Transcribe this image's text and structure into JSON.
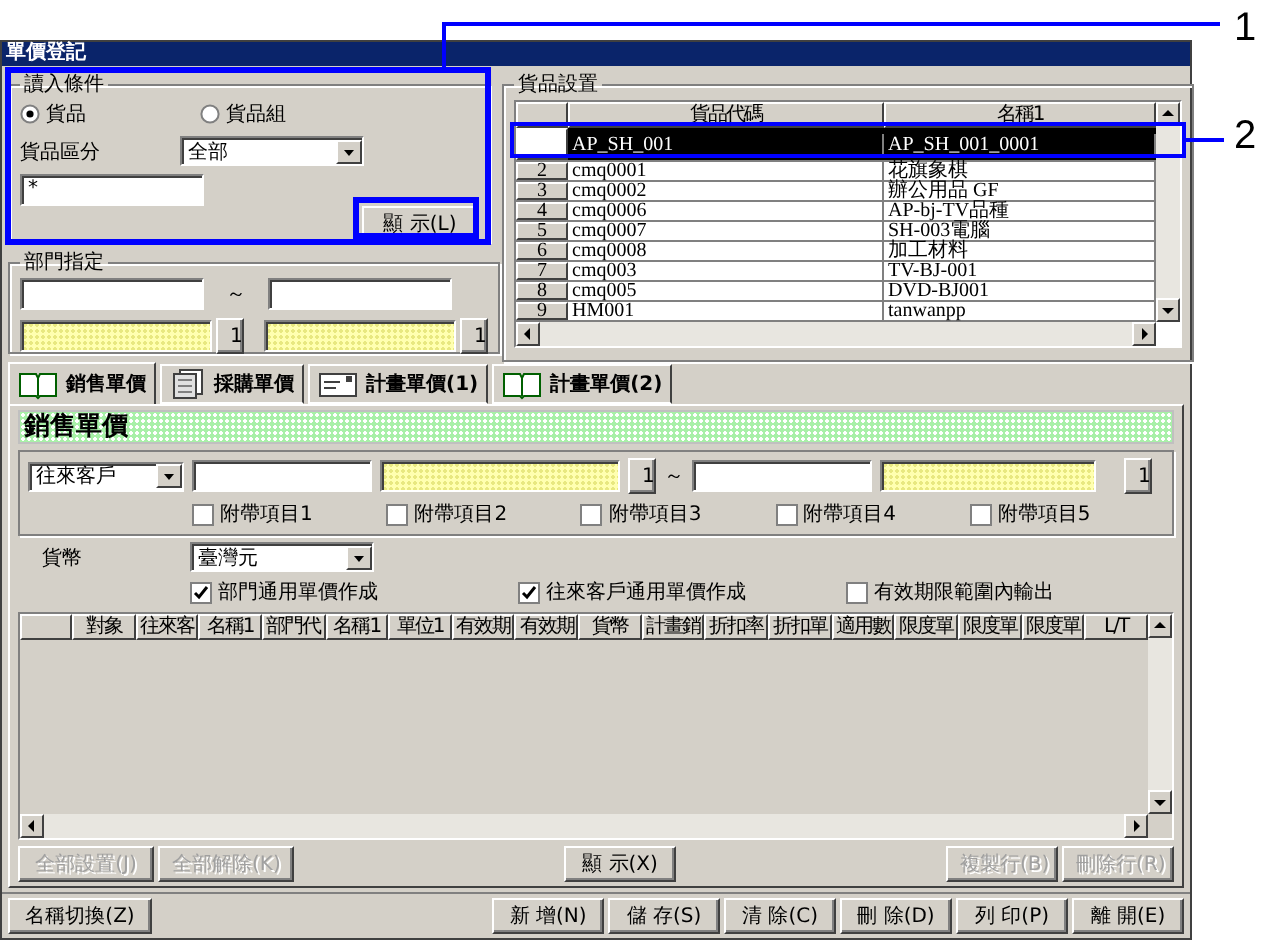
{
  "window": {
    "title": "單價登記"
  },
  "read_conditions": {
    "legend": "讀入條件",
    "options": [
      {
        "label": "貨品",
        "selected": true
      },
      {
        "label": "貨品組",
        "selected": false
      }
    ],
    "category_label": "貨品區分",
    "category_value": "全部",
    "code_value": "*",
    "show_button": "顯 示(L)"
  },
  "department": {
    "legend": "部門指定",
    "tilde": "～",
    "lookup_buttons": [
      "1",
      "1"
    ]
  },
  "item_settings": {
    "legend": "貨品設置",
    "columns": [
      "貨品代碼",
      "名稱1"
    ],
    "rows": [
      {
        "code": "AP_SH_001",
        "name": "AP_SH_001_0001",
        "selected": true
      },
      {
        "num": "2",
        "code": "cmq0001",
        "name": "花旗象棋",
        "selected": false
      },
      {
        "num": "3",
        "code": "cmq0002",
        "name": "辦公用品 GF",
        "selected": false
      },
      {
        "num": "4",
        "code": "cmq0006",
        "name": "AP-bj-TV品種",
        "selected": false
      },
      {
        "num": "5",
        "code": "cmq0007",
        "name": "SH-003電腦",
        "selected": false
      },
      {
        "num": "6",
        "code": "cmq0008",
        "name": "加工材料",
        "selected": false
      },
      {
        "num": "7",
        "code": "cmq003",
        "name": "TV-BJ-001",
        "selected": false
      },
      {
        "num": "8",
        "code": "cmq005",
        "name": "DVD-BJ001",
        "selected": false
      },
      {
        "num": "9",
        "code": "HM001",
        "name": "tanwanpp",
        "selected": false
      }
    ]
  },
  "tabs": [
    {
      "label": "銷售單價",
      "kind": "book",
      "selected": true
    },
    {
      "label": "採購單價",
      "kind": "ledger",
      "selected": false
    },
    {
      "label": "計畫單價(1)",
      "kind": "envelope",
      "selected": false
    },
    {
      "label": "計畫單價(2)",
      "kind": "book",
      "selected": false
    }
  ],
  "sales_price": {
    "title": "銷售單價",
    "partner_select": "往來客戶",
    "tilde": "～",
    "lookup_buttons": [
      "1",
      "1"
    ],
    "extras": [
      {
        "label": "附帶項目1",
        "checked": false
      },
      {
        "label": "附帶項目2",
        "checked": false
      },
      {
        "label": "附帶項目3",
        "checked": false
      },
      {
        "label": "附帶項目4",
        "checked": false
      },
      {
        "label": "附帶項目5",
        "checked": false
      }
    ],
    "currency_label": "貨幣",
    "currency_value": "臺灣元",
    "options": [
      {
        "label": "部門通用單價作成",
        "checked": true
      },
      {
        "label": "往來客戶通用單價作成",
        "checked": true
      },
      {
        "label": "有效期限範圍內輸出",
        "checked": false
      }
    ],
    "columns": [
      "對象",
      "往來客",
      "名稱1",
      "部門代",
      "名稱1",
      "單位1",
      "有效期",
      "有效期",
      "貨幣",
      "計畫銷",
      "折扣率",
      "折扣單",
      "適用數",
      "限度單",
      "限度單",
      "限度單",
      "L/T"
    ],
    "left_buttons": [
      {
        "label": "全部設置(J)",
        "disabled": true
      },
      {
        "label": "全部解除(K)",
        "disabled": true
      }
    ],
    "center_button": {
      "label": "顯 示(X)",
      "disabled": false
    },
    "right_buttons": [
      {
        "label": "複製行(B)",
        "disabled": true
      },
      {
        "label": "刪除行(R)",
        "disabled": true
      }
    ]
  },
  "footer": {
    "name_toggle": "名稱切換(Z)",
    "actions": [
      "新 增(N)",
      "儲 存(S)",
      "清 除(C)",
      "刪 除(D)",
      "列 印(P)",
      "離 開(E)"
    ]
  },
  "callouts": [
    {
      "label": "1"
    },
    {
      "label": "2"
    }
  ]
}
